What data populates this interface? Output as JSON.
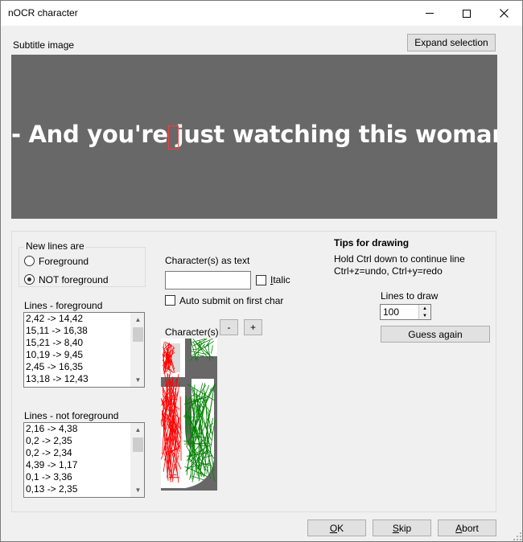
{
  "window": {
    "title": "nOCR character"
  },
  "subtitle": {
    "label": "Subtitle image",
    "expand_button": "Expand selection",
    "text": "- And you're just watching this woman,"
  },
  "new_lines": {
    "group_label": "New lines are",
    "foreground": "Foreground",
    "not_foreground": "NOT foreground",
    "selected": "NOT foreground"
  },
  "lines_foreground": {
    "label": "Lines - foreground",
    "items": [
      "2,42 -> 14,42",
      "15,11 -> 16,38",
      "15,21 -> 8,40",
      "10,19 -> 9,45",
      "2,45 -> 16,35",
      "13,18 -> 12,43"
    ]
  },
  "lines_not_foreground": {
    "label": "Lines - not foreground",
    "items": [
      "2,16 -> 4,38",
      "0,2 -> 2,35",
      "0,2 -> 2,34",
      "4,39 -> 1,17",
      "0,1 -> 3,36",
      "0,13 -> 2,35"
    ]
  },
  "char_text": {
    "label": "Character(s) as text",
    "value": "",
    "italic": "Italic",
    "italic_checked": false,
    "auto_submit": "Auto submit on first char",
    "auto_submit_checked": false
  },
  "characters": {
    "label": "Character(s)",
    "minus": "-",
    "plus": "+"
  },
  "tips": {
    "title": "Tips for drawing",
    "line1": "Hold Ctrl down to continue line",
    "line2": "Ctrl+z=undo, Ctrl+y=redo"
  },
  "lines_to_draw": {
    "label": "Lines to draw",
    "value": "100"
  },
  "guess_button": "Guess again",
  "footer": {
    "ok": "OK",
    "skip": "Skip",
    "abort": "Abort"
  },
  "colors": {
    "image_bg": "#686868",
    "foreground_line": "#ff0000",
    "not_foreground_line": "#008000"
  }
}
